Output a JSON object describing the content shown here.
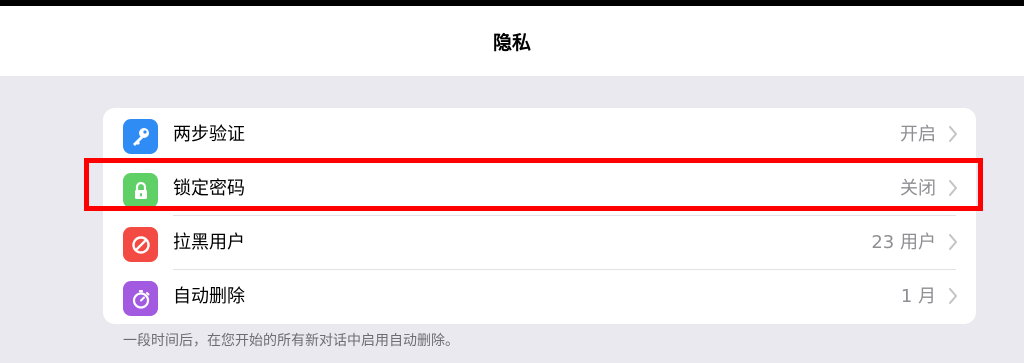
{
  "header": {
    "title": "隐私"
  },
  "settings": {
    "items": [
      {
        "label": "两步验证",
        "value": "开启",
        "icon": "key-icon",
        "color": "#2f8cf4"
      },
      {
        "label": "锁定密码",
        "value": "关闭",
        "icon": "lock-icon",
        "color": "#5ed066"
      },
      {
        "label": "拉黑用户",
        "value": "23 用户",
        "icon": "block-icon",
        "color": "#f34a44"
      },
      {
        "label": "自动删除",
        "value": "1 月",
        "icon": "timer-icon",
        "color": "#a15ae0"
      }
    ]
  },
  "footer": {
    "note": "一段时间后，在您开始的所有新对话中启用自动删除。"
  },
  "highlight": {
    "color": "#ff0000",
    "target": "锁定密码"
  }
}
